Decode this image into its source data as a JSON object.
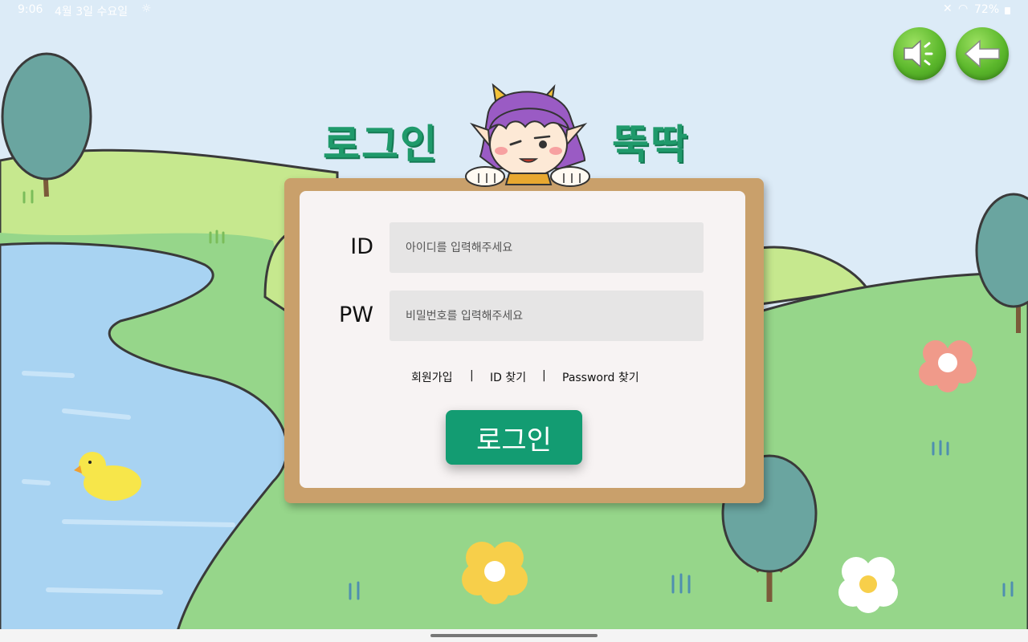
{
  "status_bar": {
    "time": "9:06",
    "date": "4월 3일 수요일",
    "battery": "72%"
  },
  "title": {
    "left": "로그인",
    "right": "뚝딱"
  },
  "form": {
    "id_label": "ID",
    "pw_label": "PW",
    "id_placeholder": "아이디를 입력해주세요",
    "pw_placeholder": "비밀번호를 입력해주세요"
  },
  "links": {
    "signup": "회원가입",
    "separator": "|",
    "find_id": "ID 찾기",
    "find_password": "Password 찾기"
  },
  "login_button": "로그인",
  "colors": {
    "accent": "#139c72",
    "title": "#1f9a6b",
    "board": "#c9a06b",
    "panel": "#f7f3f3",
    "round_button": "#5cb82c"
  },
  "icons": {
    "sound": "speaker-icon",
    "back": "arrow-left-icon"
  }
}
